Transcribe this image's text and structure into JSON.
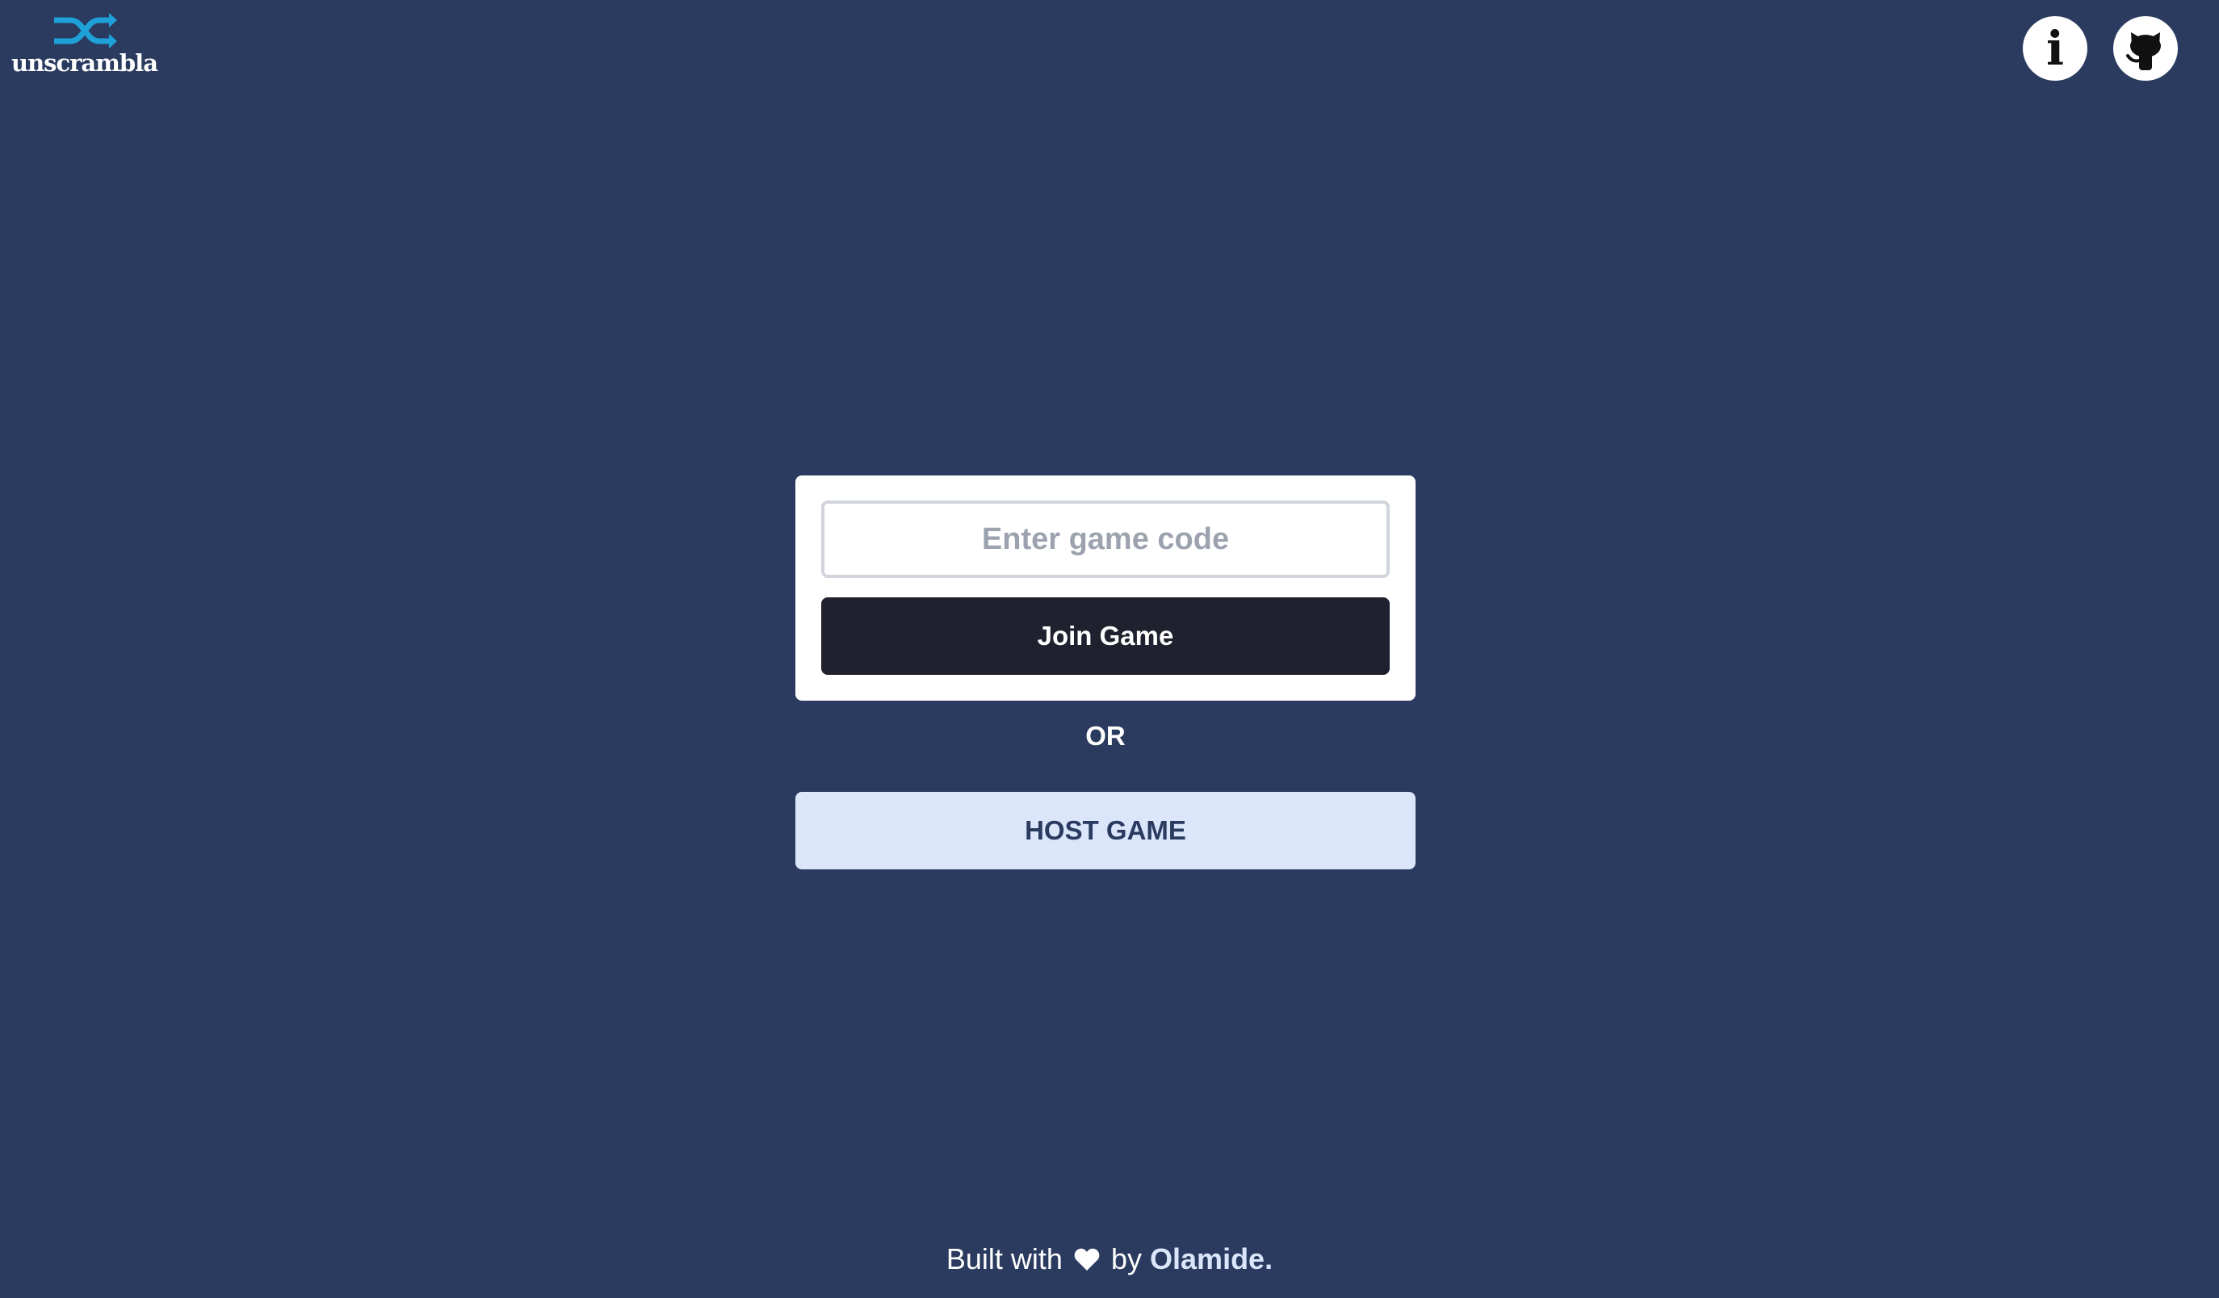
{
  "header": {
    "logo_text": "unscrambla",
    "logo_icon": "shuffle-icon",
    "info_icon": "info-icon",
    "info_glyph": "i",
    "github_icon": "github-icon"
  },
  "join": {
    "code_input_placeholder": "Enter game code",
    "code_input_value": "",
    "join_label": "Join Game"
  },
  "divider_text": "OR",
  "host": {
    "label": "HOST GAME"
  },
  "footer": {
    "prefix": "Built with",
    "heart_icon": "heart-icon",
    "by_text": "by",
    "author": "Olamide."
  },
  "colors": {
    "background": "#2a3b5f",
    "logo_accent": "#1da1d8",
    "join_button": "#1f212e",
    "host_button": "#dbe6fb",
    "card": "#ffffff"
  }
}
